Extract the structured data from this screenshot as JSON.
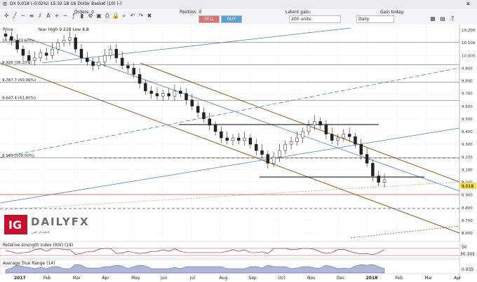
{
  "window": {
    "title": "DX 9,018 (-0.02%) 15:32:18 US Dollar Basket (10) (-)",
    "close_icon": "close-icon",
    "menu_icon": "menu-icon"
  },
  "orders": {
    "orders_label": "Orders: 0",
    "position_label": "Position: 0",
    "latent_label": "Latent gain:",
    "gain_label": "Gain today:"
  },
  "trade": {
    "sell_label": "SELL",
    "buy_label": "BUY",
    "units_value": "200 units",
    "timeframe_value": "Daily"
  },
  "chart": {
    "price_label": "Price",
    "high_low_label": "Year High 9.228 Low 8.8",
    "watermark_brand": "DAILYFX",
    "watermark_sub": "مقدم من",
    "rsi_label": "Relative strength index (RSI) (14)",
    "atr_label": "Average True Range (14)",
    "current_price": "9.018"
  },
  "chart_data": {
    "type": "candlestick",
    "x_ticks": [
      "2017",
      "Feb",
      "Mar",
      "Apr",
      "May",
      "Jun",
      "Jul",
      "Aug",
      "Sep",
      "Oct",
      "Nov",
      "Dec",
      "2018",
      "Feb",
      "Mar",
      "Apr"
    ],
    "y_ticks": [
      "10.200",
      "10.100",
      "10.000",
      "9.900",
      "9.800",
      "9.700",
      "9.600",
      "9.500",
      "9.400",
      "9.300",
      "9.200",
      "9.100",
      "9.000",
      "8.900",
      "8.800",
      "8.700",
      "8.600"
    ],
    "fib_levels": [
      {
        "label": "10.102 (23.60%)",
        "value": 10.102
      },
      {
        "label": "9.928 (38.20%)",
        "value": 9.928
      },
      {
        "label": "9.787.7 (50.00%)",
        "value": 9.788
      },
      {
        "label": "9.647.4 (61.80%)",
        "value": 9.647
      },
      {
        "label": "9.193 (100.00%)",
        "value": 9.193
      }
    ],
    "close_series": [
      10.15,
      10.12,
      10.05,
      10.0,
      9.96,
      9.98,
      10.02,
      10.0,
      10.05,
      10.1,
      10.12,
      10.14,
      10.05,
      9.98,
      9.95,
      9.92,
      9.95,
      10.0,
      10.05,
      9.98,
      9.92,
      9.9,
      9.85,
      9.78,
      9.72,
      9.7,
      9.68,
      9.7,
      9.68,
      9.72,
      9.7,
      9.65,
      9.6,
      9.55,
      9.5,
      9.45,
      9.4,
      9.35,
      9.33,
      9.35,
      9.33,
      9.35,
      9.3,
      9.25,
      9.22,
      9.15,
      9.2,
      9.25,
      9.3,
      9.32,
      9.35,
      9.4,
      9.45,
      9.48,
      9.45,
      9.38,
      9.33,
      9.35,
      9.38,
      9.36,
      9.3,
      9.22,
      9.15,
      9.05,
      9.0,
      9.02
    ],
    "rsi": {
      "levels": [
        "50",
        "30.305"
      ]
    },
    "atr": {
      "value": "0.035"
    }
  },
  "colors": {
    "channel_brown": "#8b5a2b",
    "trend_blue": "#4a7fc1",
    "red_line": "#d9534f",
    "ig_red": "#c8102e",
    "price_tag": "#f5e04a"
  }
}
